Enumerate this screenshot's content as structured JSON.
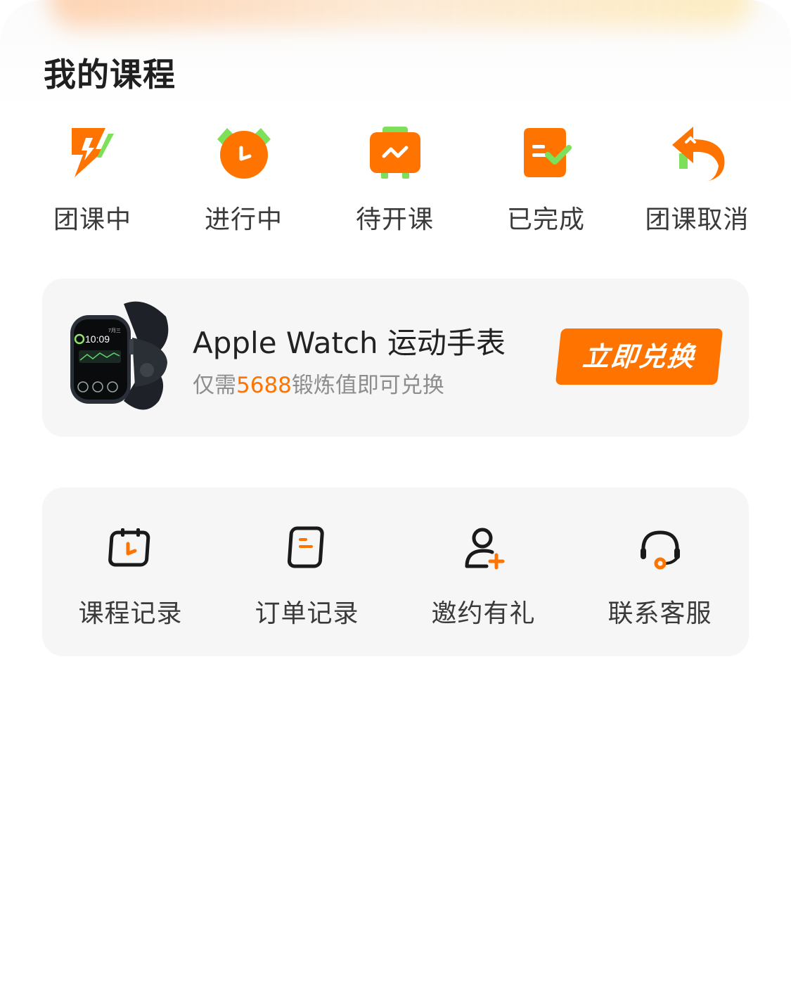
{
  "my_courses": {
    "title": "我的课程",
    "statuses": [
      {
        "label": "团课中",
        "icon": "lightning-icon"
      },
      {
        "label": "进行中",
        "icon": "alarm-clock-icon"
      },
      {
        "label": "待开课",
        "icon": "briefcase-icon"
      },
      {
        "label": "已完成",
        "icon": "completed-doc-icon"
      },
      {
        "label": "团课取消",
        "icon": "undo-arrow-icon"
      }
    ]
  },
  "promo": {
    "title": "Apple Watch 运动手表",
    "sub_prefix": "仅需",
    "points": "5688",
    "sub_suffix": "锻炼值即可兑换",
    "button_label": "立即兑换",
    "watch_time": "10:09",
    "watch_date": "7月三",
    "image": "apple-watch-image"
  },
  "services": [
    {
      "label": "课程记录",
      "icon": "calendar-clock-icon"
    },
    {
      "label": "订单记录",
      "icon": "order-doc-icon"
    },
    {
      "label": "邀约有礼",
      "icon": "add-user-icon"
    },
    {
      "label": "联系客服",
      "icon": "headset-icon"
    }
  ],
  "colors": {
    "accent": "#ff7400",
    "accent_green": "#7ee05a",
    "text": "#3a3a3a",
    "panel": "#f6f6f6"
  }
}
